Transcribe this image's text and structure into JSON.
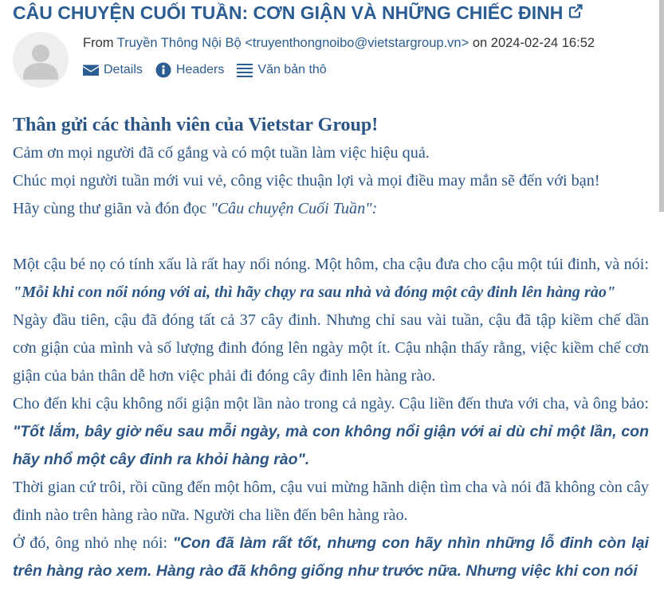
{
  "email": {
    "subject": "CÂU CHUYỆN CUỐI TUẦN: CƠN GIẬN VÀ NHỮNG CHIẾC ĐINH",
    "from_prefix": "From ",
    "sender": "Truyền Thông Nội Bộ <truyenthongnoibo@vietstargroup.vn>",
    "on_text": " on ",
    "date": "2024-02-24 16:52",
    "actions": {
      "details": "Details",
      "headers": "Headers",
      "raw": "Văn bản thô"
    }
  },
  "body": {
    "greeting": "Thân gửi các thành viên của Vietstar Group!",
    "line1": "Cảm ơn mọi người đã cố gắng và có một tuần làm việc hiệu quả.",
    "line2": "Chúc mọi người tuần mới vui vẻ, công việc thuận lợi và mọi điều may mắn sẽ đến với bạn!",
    "line3_a": "Hãy cùng thư giãn và đón đọc ",
    "line3_b": "\"Câu chuyện Cuối Tuần\":",
    "p1_a": "Một cậu bé nọ có tính xấu là rất hay nổi nóng. Một hôm, cha cậu đưa cho cậu một túi đinh, và nói: ",
    "p1_b": "\"Mỗi khi con nổi nóng với ai, thì hãy chạy ra sau nhà và đóng một cây đinh lên hàng rào\"",
    "p2": "Ngày đầu tiên, cậu đã đóng tất cả 37 cây đinh. Nhưng chỉ sau vài tuần, cậu đã tập kiềm chế dần cơn giận của mình và số lượng đinh đóng lên ngày một ít. Cậu nhận thấy rằng, việc kiềm chế cơn giận của bản thân dễ hơn việc phải đi đóng cây đinh lên hàng rào.",
    "p3_a": "Cho đến khi cậu không nổi giận một lần nào trong cả ngày. Cậu liền đến thưa với cha, và ông bảo: ",
    "p3_b": "\"Tốt lắm, bây giờ nếu sau mỗi ngày, mà con không nổi giận với ai dù chỉ một lần, con hãy nhổ một cây đinh ra khỏi hàng rào\"",
    "p3_c": ".",
    "p4": "Thời gian cứ trôi, rồi cũng đến một hôm, cậu vui mừng hãnh diện tìm cha và nói đã không còn cây đinh nào trên hàng rào nữa. Người cha liền đến bên hàng rào.",
    "p5_a": "Ở đó, ông nhỏ nhẹ nói: ",
    "p5_b": "\"Con đã làm rất tốt, nhưng con hãy nhìn những lỗ đinh còn lại trên hàng rào xem. Hàng rào đã không giống như trước nữa. Nhưng việc khi con nói"
  },
  "colors": {
    "accent": "#2b5d92",
    "body_text": "#2b5585"
  }
}
